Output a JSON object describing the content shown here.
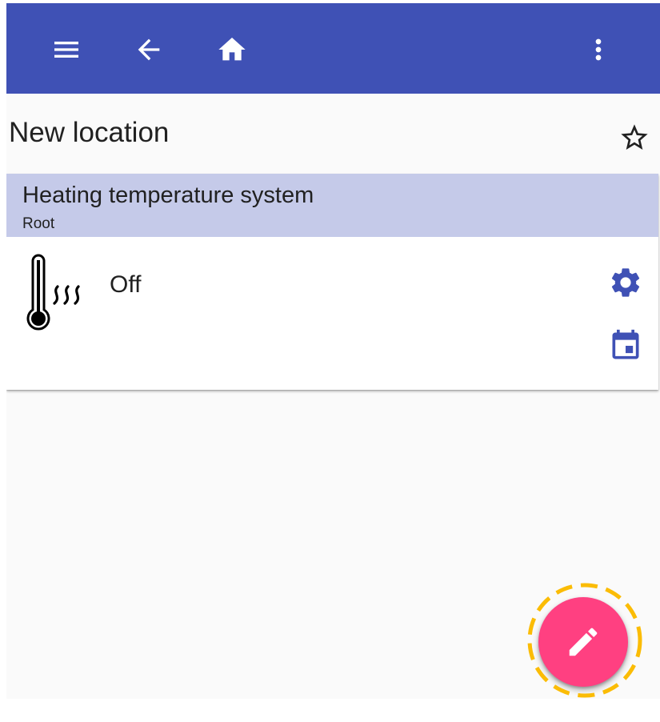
{
  "appbar": {
    "background": "#3f51b5",
    "icons": {
      "menu": "menu-icon",
      "back": "arrow-back-icon",
      "home": "home-icon",
      "more": "more-vert-icon"
    }
  },
  "page": {
    "title": "New location",
    "favorite_icon": "star-outline-icon"
  },
  "device_card": {
    "title": "Heating temperature system",
    "subtitle": "Root",
    "status": "Off",
    "device_icon": "thermometer-heat-icon",
    "header_color": "#c5cae9",
    "actions": {
      "settings": "gear-icon",
      "schedule": "calendar-icon"
    }
  },
  "fab": {
    "icon": "pencil-icon",
    "color": "#ff4081",
    "highlight_color": "#fbbc05"
  }
}
